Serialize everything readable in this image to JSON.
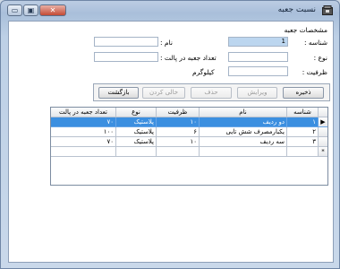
{
  "window": {
    "title": "نسبت جعبه",
    "controls": {
      "minimize": "▭",
      "maximize": "▣",
      "close": "✕"
    }
  },
  "form": {
    "group_title": "مشخصات جعبه",
    "code_label": "شناسه :",
    "code_value": "1",
    "name_label": "نام :",
    "name_value": "",
    "type_label": "نوع :",
    "type_value": "",
    "count_label": "تعداد جعبه در پالت :",
    "count_value": "",
    "capacity_label": "ظرفیت :",
    "capacity_value": "",
    "capacity_unit": "کیلوگرم"
  },
  "toolbar": {
    "save": "ذخیره",
    "edit": "ویرایش",
    "delete": "حذف",
    "clear": "خالی کردن",
    "back": "بازگشت"
  },
  "grid": {
    "headers": {
      "code": "شناسه",
      "name": "نام",
      "capacity": "ظرفیت",
      "type": "نوع",
      "count": "تعداد جعبه در پالت"
    },
    "rows": [
      {
        "code": "۱",
        "name": "دو ردیف",
        "capacity": "۱۰",
        "type": "پلاستیک",
        "count": "۷۰",
        "marker": "▶"
      },
      {
        "code": "۲",
        "name": "یکبارمصرف شش تایی",
        "capacity": "۶",
        "type": "پلاستیک",
        "count": "۱۰۰",
        "marker": ""
      },
      {
        "code": "۳",
        "name": "سه ردیف",
        "capacity": "۱۰",
        "type": "پلاستیک",
        "count": "۷۰",
        "marker": ""
      }
    ],
    "new_row_marker": "*"
  }
}
